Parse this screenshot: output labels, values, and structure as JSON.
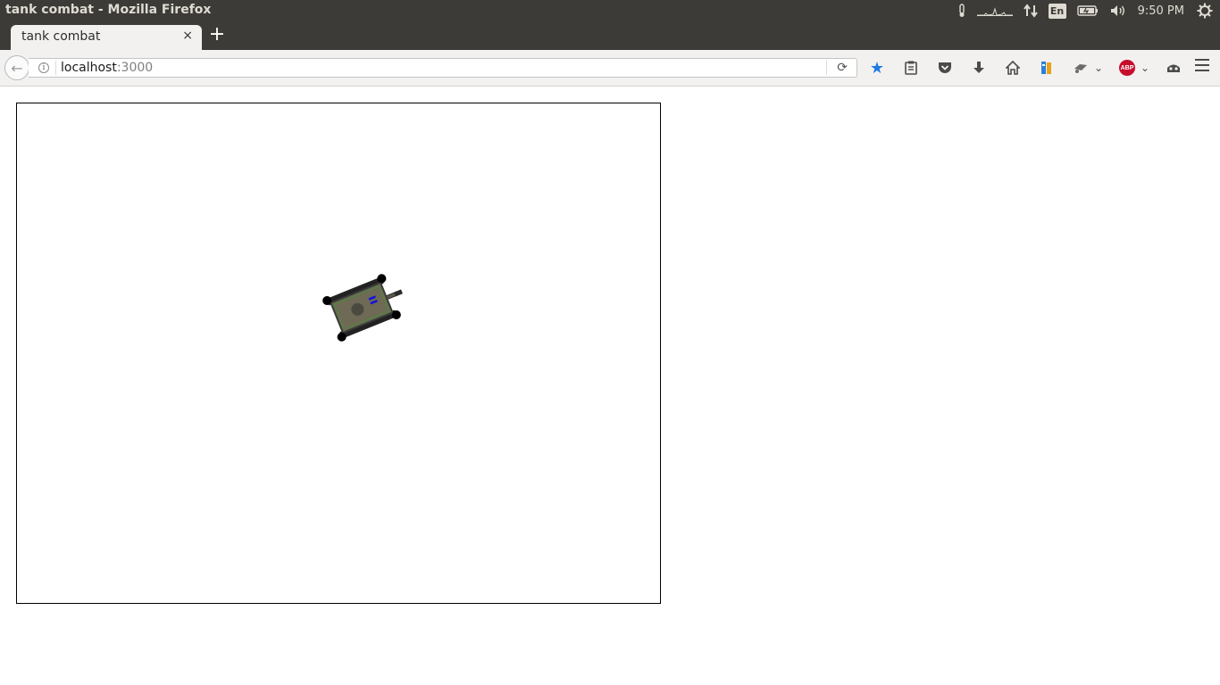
{
  "window": {
    "title": "tank combat - Mozilla Firefox"
  },
  "panel": {
    "language": "En",
    "clock": "9:50 PM",
    "icons": [
      "thermometer-icon",
      "system-monitor-icon",
      "network-icon",
      "keyboard-language-icon",
      "battery-icon",
      "volume-icon",
      "power-settings-icon"
    ]
  },
  "tabs": [
    {
      "label": "tank combat",
      "close": "×"
    }
  ],
  "new_tab_label": "+",
  "navbar": {
    "back": "←",
    "info": "i",
    "url_host": "localhost",
    "url_port": ":3000",
    "reload": "⟳"
  },
  "toolbar": {
    "icons": [
      "bookmark-star-icon",
      "reading-list-icon",
      "pocket-icon",
      "download-icon",
      "home-icon",
      "library-icon",
      "extension-icon",
      "adblock-icon",
      "account-icon"
    ],
    "adblock_label": "ABP"
  },
  "game": {
    "tank": {
      "body_color": "#6e6a55",
      "track_color": "#222222",
      "trim_color": "#4a8a3a",
      "flag_color": "#1010e0"
    }
  },
  "colors": {
    "panel_bg": "#3c3b37",
    "chrome_bg": "#f2f1f0",
    "accent": "#1f7ae0"
  }
}
